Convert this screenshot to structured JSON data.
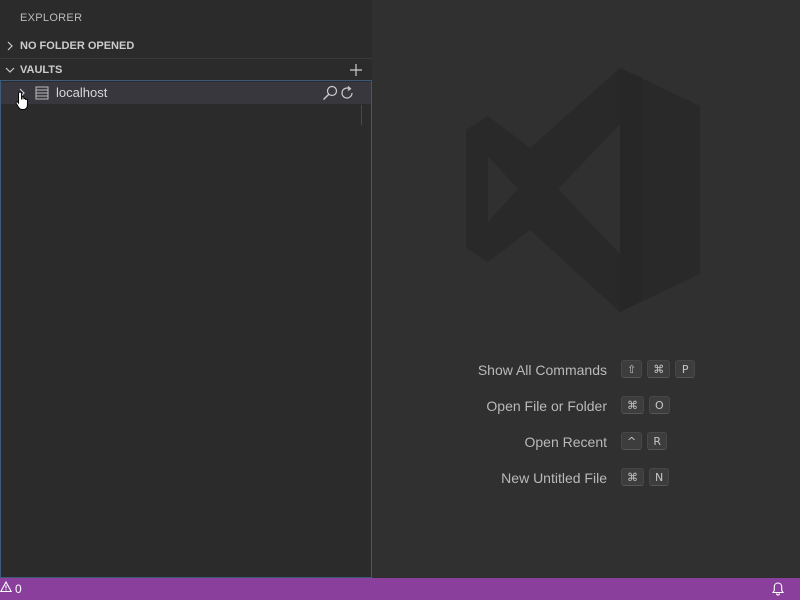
{
  "sidebar": {
    "title": "EXPLORER",
    "folder_section": {
      "label": "NO FOLDER OPENED",
      "expanded": false
    },
    "vaults_section": {
      "label": "VAULTS",
      "expanded": true,
      "add_icon": "plus-icon",
      "items": [
        {
          "label": "localhost",
          "icon": "database-icon",
          "expanded": false,
          "actions": [
            "search-icon",
            "refresh-icon"
          ]
        }
      ]
    }
  },
  "editor": {
    "watermark_icon": "vscode-logo",
    "shortcuts": [
      {
        "label": "Show All Commands",
        "keys": [
          "⇧",
          "⌘",
          "P"
        ]
      },
      {
        "label": "Open File or Folder",
        "keys": [
          "⌘",
          "O"
        ]
      },
      {
        "label": "Open Recent",
        "keys": [
          "^",
          "R"
        ]
      },
      {
        "label": "New Untitled File",
        "keys": [
          "⌘",
          "N"
        ]
      }
    ]
  },
  "statusbar": {
    "problems_count": "0",
    "problems_icon": "warning-icon",
    "notifications_icon": "bell-icon",
    "color": "#8a3f9c"
  }
}
